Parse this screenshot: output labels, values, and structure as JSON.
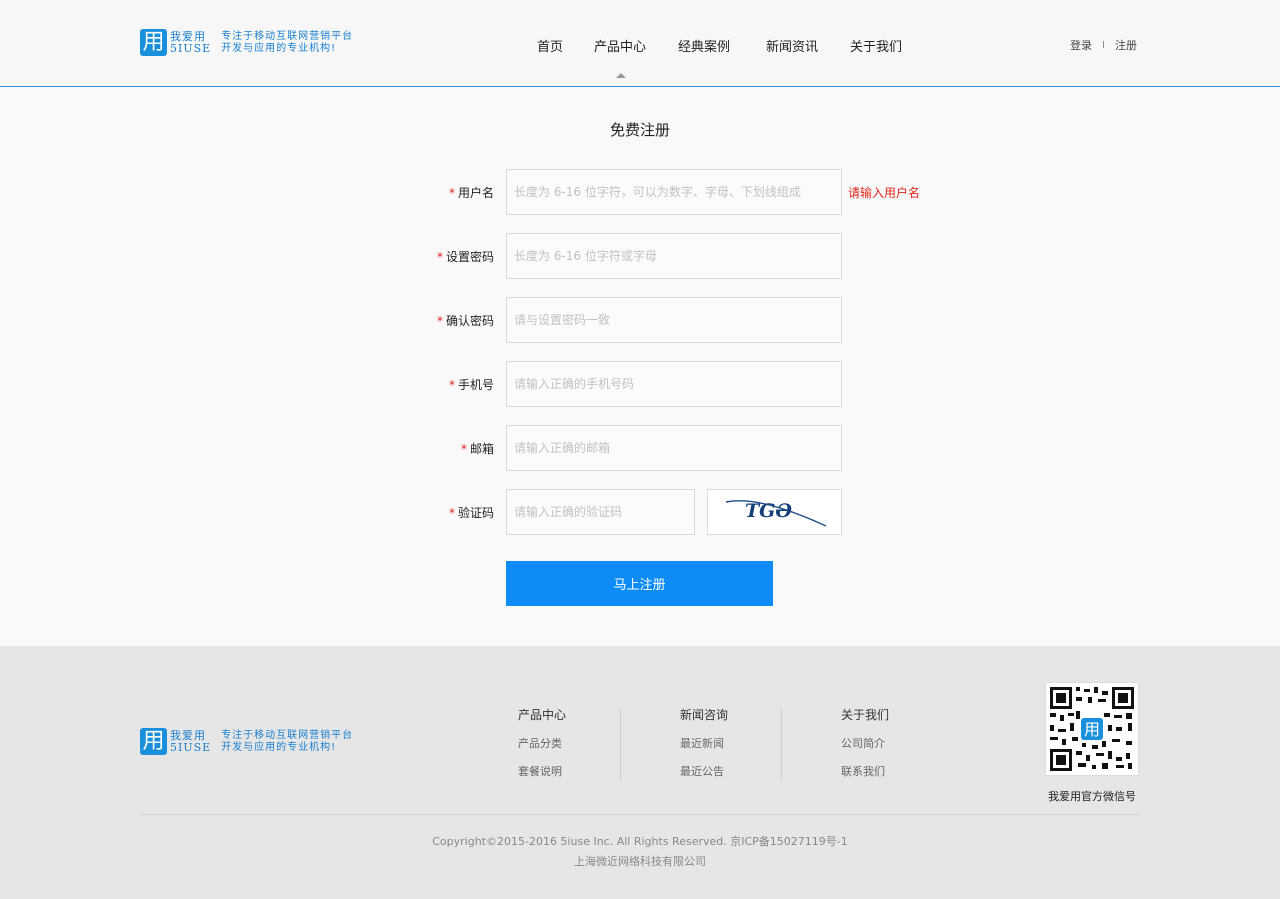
{
  "brand": {
    "mark": "用",
    "name_cn": "我爱用",
    "name_en": "5IUSE",
    "slogan_line1": "专注于移动互联网营销平台",
    "slogan_line2": "开发与应用的专业机构!"
  },
  "nav": {
    "items": [
      "首页",
      "产品中心",
      "经典案例",
      "新闻资讯",
      "关于我们"
    ],
    "active_index": 1
  },
  "auth": {
    "login": "登录",
    "separator": "I",
    "register": "注册"
  },
  "form": {
    "title": "免费注册",
    "required_mark": "*",
    "fields": [
      {
        "label": "用户名",
        "placeholder": "长度为 6-16 位字符，可以为数字、字母、下划线组成",
        "error": "请输入用户名"
      },
      {
        "label": "设置密码",
        "placeholder": "长度为 6-16 位字符或字母"
      },
      {
        "label": "确认密码",
        "placeholder": "请与设置密码一致"
      },
      {
        "label": "手机号",
        "placeholder": "请输入正确的手机号码"
      },
      {
        "label": "邮箱",
        "placeholder": "请输入正确的邮箱"
      },
      {
        "label": "验证码",
        "placeholder": "请输入正确的验证码"
      }
    ],
    "captcha_text": "TGƏ",
    "submit_label": "马上注册"
  },
  "footer": {
    "columns": [
      {
        "title": "产品中心",
        "links": [
          "产品分类",
          "套餐说明"
        ]
      },
      {
        "title": "新闻咨询",
        "links": [
          "最近新闻",
          "最近公告"
        ]
      },
      {
        "title": "关于我们",
        "links": [
          "公司简介",
          "联系我们"
        ]
      }
    ],
    "qr_caption": "我爱用官方微信号",
    "copyright": "Copyright©2015-2016 5iuse Inc. All Rights Reserved. 京ICP备15027119号-1",
    "company": "上海微近网络科技有限公司"
  },
  "colors": {
    "accent": "#0d8cf5",
    "brand_blue": "#1a8fdc",
    "error_red": "#e1251b"
  }
}
